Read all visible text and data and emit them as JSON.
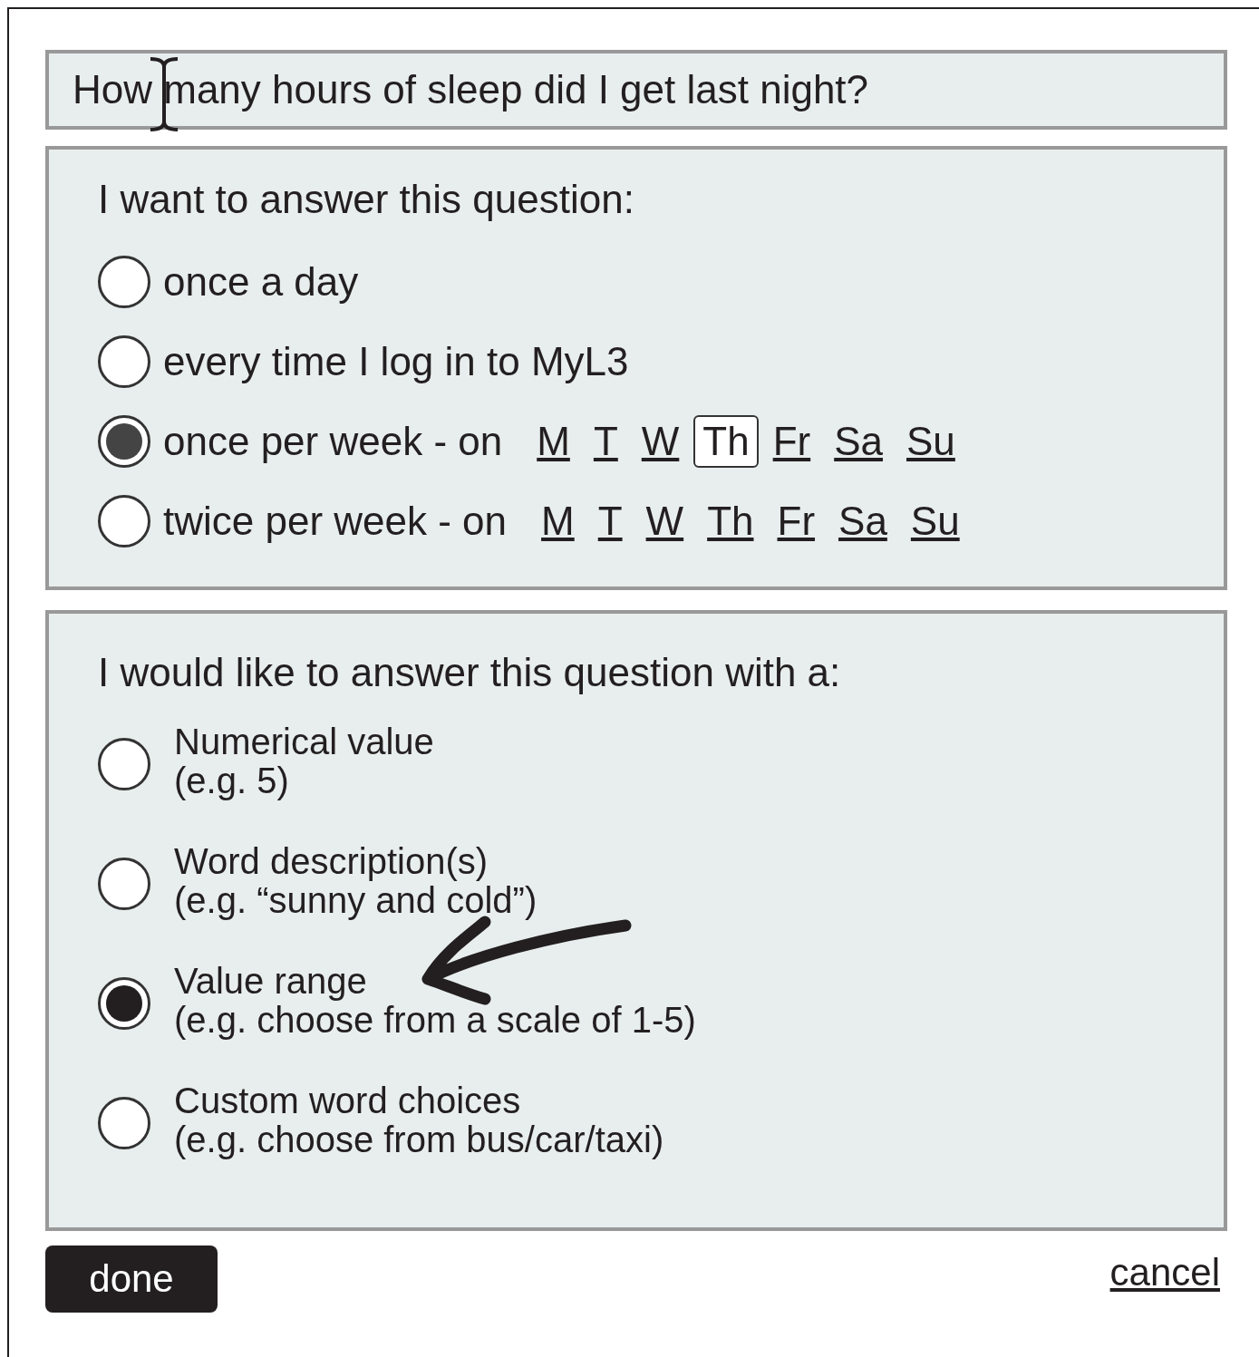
{
  "question": {
    "value": "How many hours of sleep did I get last night?"
  },
  "frequency": {
    "label": "I want to answer this question:",
    "options": [
      {
        "kind": "plain",
        "label": "once a day",
        "selected": false
      },
      {
        "kind": "plain",
        "label": "every time I log in to MyL3",
        "selected": false
      },
      {
        "kind": "days",
        "label": "once per week - on",
        "selected": true,
        "days": [
          {
            "label": "M",
            "selected": false
          },
          {
            "label": "T",
            "selected": false
          },
          {
            "label": "W",
            "selected": false
          },
          {
            "label": "Th",
            "selected": true
          },
          {
            "label": "Fr",
            "selected": false
          },
          {
            "label": "Sa",
            "selected": false
          },
          {
            "label": "Su",
            "selected": false
          }
        ]
      },
      {
        "kind": "days",
        "label": "twice per week - on",
        "selected": false,
        "days": [
          {
            "label": "M",
            "selected": false
          },
          {
            "label": "T",
            "selected": false
          },
          {
            "label": "W",
            "selected": false
          },
          {
            "label": "Th",
            "selected": false
          },
          {
            "label": "Fr",
            "selected": false
          },
          {
            "label": "Sa",
            "selected": false
          },
          {
            "label": "Su",
            "selected": false
          }
        ]
      }
    ]
  },
  "answer_type": {
    "label": "I would like to answer this question with a:",
    "options": [
      {
        "label": "Numerical value",
        "example": "(e.g. 5)",
        "selected": false
      },
      {
        "label": "Word description(s)",
        "example": "(e.g. “sunny and cold”)",
        "selected": false
      },
      {
        "label": "Value range",
        "example": "(e.g. choose from a scale of 1-5)",
        "selected": true
      },
      {
        "label": "Custom word choices",
        "example": "(e.g. choose from bus/car/taxi)",
        "selected": false
      }
    ]
  },
  "buttons": {
    "done": "done",
    "cancel": "cancel"
  }
}
